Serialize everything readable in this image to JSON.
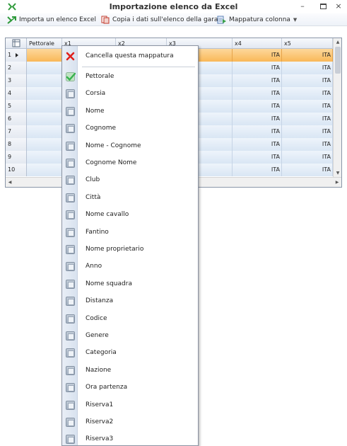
{
  "window": {
    "title": "Importazione elenco da Excel",
    "minimize_symbol": "–",
    "close_symbol": "×"
  },
  "toolbar": {
    "items": [
      {
        "label": "Importa un elenco Excel",
        "icon": "excel-import-icon"
      },
      {
        "label": "Copia i dati sull'elenco della gara",
        "icon": "copy-icon"
      },
      {
        "label": "Mappatura colonna",
        "icon": "mapping-icon",
        "dropdown": true
      }
    ]
  },
  "grid": {
    "columns": [
      "Pettorale",
      "x1",
      "x2",
      "x3",
      "x4",
      "x5"
    ],
    "rows": [
      {
        "num": "1",
        "x4": "ITA",
        "x5": "ITA",
        "current": true
      },
      {
        "num": "2",
        "x4": "ITA",
        "x5": "ITA"
      },
      {
        "num": "3",
        "x4": "ITA",
        "x5": "ITA"
      },
      {
        "num": "4",
        "x4": "ITA",
        "x5": "ITA"
      },
      {
        "num": "5",
        "x4": "ITA",
        "x5": "ITA"
      },
      {
        "num": "6",
        "x4": "ITA",
        "x5": "ITA"
      },
      {
        "num": "7",
        "x4": "ITA",
        "x5": "ITA"
      },
      {
        "num": "8",
        "x4": "ITA",
        "x5": "ITA"
      },
      {
        "num": "9",
        "x4": "ITA",
        "x5": "ITA"
      },
      {
        "num": "10",
        "x4": "ITA",
        "x5": "ITA"
      }
    ]
  },
  "context_menu": {
    "clear_label": "Cancella questa mappatura",
    "items": [
      {
        "label": "Pettorale",
        "checked": true
      },
      {
        "label": "Corsia",
        "checked": false
      },
      {
        "label": "Nome",
        "checked": false
      },
      {
        "label": "Cognome",
        "checked": false
      },
      {
        "label": "Nome - Cognome",
        "checked": false
      },
      {
        "label": "Cognome Nome",
        "checked": false
      },
      {
        "label": "Club",
        "checked": false
      },
      {
        "label": "Città",
        "checked": false
      },
      {
        "label": "Nome cavallo",
        "checked": false
      },
      {
        "label": "Fantino",
        "checked": false
      },
      {
        "label": "Nome proprietario",
        "checked": false
      },
      {
        "label": "Anno",
        "checked": false
      },
      {
        "label": "Nome squadra",
        "checked": false
      },
      {
        "label": "Distanza",
        "checked": false
      },
      {
        "label": "Codice",
        "checked": false
      },
      {
        "label": "Genere",
        "checked": false
      },
      {
        "label": "Categoria",
        "checked": false
      },
      {
        "label": "Nazione",
        "checked": false
      },
      {
        "label": "Ora partenza",
        "checked": false
      },
      {
        "label": "Riserva1",
        "checked": false
      },
      {
        "label": "Riserva2",
        "checked": false
      },
      {
        "label": "Riserva3",
        "checked": false
      }
    ]
  },
  "colors": {
    "selected_row": "#f9b858",
    "cell_blue": "#d9e6f4",
    "clear_red": "#e0201c",
    "check_green": "#37b24d",
    "excel_green": "#2e9a3a"
  }
}
